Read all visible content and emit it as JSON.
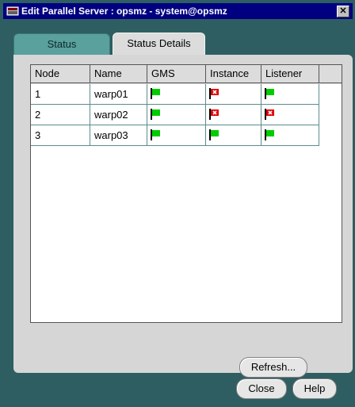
{
  "window": {
    "title": "Edit Parallel Server : opsmz - system@opsmz",
    "close_glyph": "✕"
  },
  "tabs": [
    {
      "label": "Status",
      "selected": false
    },
    {
      "label": "Status Details",
      "selected": true
    }
  ],
  "table": {
    "columns": [
      "Node",
      "Name",
      "GMS",
      "Instance",
      "Listener"
    ],
    "rows": [
      {
        "node": "1",
        "name": "warp01",
        "gms": "up",
        "instance": "down",
        "listener": "up"
      },
      {
        "node": "2",
        "name": "warp02",
        "gms": "up",
        "instance": "down",
        "listener": "down"
      },
      {
        "node": "3",
        "name": "warp03",
        "gms": "up",
        "instance": "up",
        "listener": "up"
      }
    ]
  },
  "buttons": {
    "refresh": "Refresh...",
    "close": "Close",
    "help": "Help"
  },
  "colors": {
    "flag_up": "#00cc00",
    "flag_down": "#e00000",
    "titlebar": "#000080",
    "frame": "#2e5e61"
  }
}
